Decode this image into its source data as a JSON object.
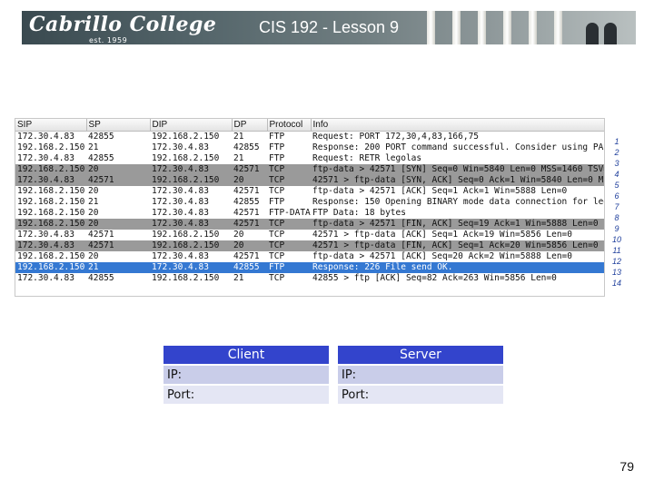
{
  "header": {
    "logo_text": "Cabrillo College",
    "logo_est": "est. 1959",
    "title": "CIS 192 - Lesson 9"
  },
  "packets": {
    "columns": [
      "SIP",
      "SP",
      "DIP",
      "DP",
      "Protocol",
      "Info"
    ],
    "rows": [
      {
        "style": "w",
        "cells": [
          "172.30.4.83",
          "42855",
          "192.168.2.150",
          "21",
          "FTP",
          "Request: PORT 172,30,4,83,166,75"
        ]
      },
      {
        "style": "w",
        "cells": [
          "192.168.2.150",
          "21",
          "172.30.4.83",
          "42855",
          "FTP",
          "Response: 200 PORT command successful. Consider using PASV"
        ]
      },
      {
        "style": "w",
        "cells": [
          "172.30.4.83",
          "42855",
          "192.168.2.150",
          "21",
          "FTP",
          "Request: RETR legolas"
        ]
      },
      {
        "style": "g",
        "cells": [
          "192.168.2.150",
          "20",
          "172.30.4.83",
          "42571",
          "TCP",
          "ftp-data > 42571 [SYN] Seq=0 Win=5840 Len=0 MSS=1460 TSV="
        ]
      },
      {
        "style": "g",
        "cells": [
          "172.30.4.83",
          "42571",
          "192.168.2.150",
          "20",
          "TCP",
          "42571 > ftp-data [SYN, ACK] Seq=0 Ack=1 Win=5840 Len=0 MS"
        ]
      },
      {
        "style": "w",
        "cells": [
          "192.168.2.150",
          "20",
          "172.30.4.83",
          "42571",
          "TCP",
          "ftp-data > 42571 [ACK] Seq=1 Ack=1 Win=5888 Len=0"
        ]
      },
      {
        "style": "w",
        "cells": [
          "192.168.2.150",
          "21",
          "172.30.4.83",
          "42855",
          "FTP",
          "Response: 150 Opening BINARY mode data connection for leg"
        ]
      },
      {
        "style": "w",
        "cells": [
          "192.168.2.150",
          "20",
          "172.30.4.83",
          "42571",
          "FTP-DATA",
          "FTP Data: 18 bytes"
        ]
      },
      {
        "style": "g",
        "cells": [
          "192.168.2.150",
          "20",
          "172.30.4.83",
          "42571",
          "TCP",
          "ftp-data > 42571 [FIN, ACK] Seq=19 Ack=1 Win=5888 Len=0"
        ]
      },
      {
        "style": "w",
        "cells": [
          "172.30.4.83",
          "42571",
          "192.168.2.150",
          "20",
          "TCP",
          "42571 > ftp-data [ACK] Seq=1 Ack=19 Win=5856 Len=0"
        ]
      },
      {
        "style": "g",
        "cells": [
          "172.30.4.83",
          "42571",
          "192.168.2.150",
          "20",
          "TCP",
          "42571 > ftp-data [FIN, ACK] Seq=1 Ack=20 Win=5856 Len=0"
        ]
      },
      {
        "style": "w",
        "cells": [
          "192.168.2.150",
          "20",
          "172.30.4.83",
          "42571",
          "TCP",
          "ftp-data > 42571 [ACK] Seq=20 Ack=2 Win=5888 Len=0"
        ]
      },
      {
        "style": "s",
        "cells": [
          "192.168.2.150",
          "21",
          "172.30.4.83",
          "42855",
          "FTP",
          "Response: 226 File send OK."
        ]
      },
      {
        "style": "w",
        "cells": [
          "172.30.4.83",
          "42855",
          "192.168.2.150",
          "21",
          "TCP",
          "42855 > ftp [ACK] Seq=82 Ack=263 Win=5856 Len=0"
        ]
      }
    ]
  },
  "line_numbers": [
    "1",
    "2",
    "3",
    "4",
    "5",
    "6",
    "7",
    "8",
    "9",
    "10",
    "11",
    "12",
    "13",
    "14"
  ],
  "client_server": {
    "client_header": "Client",
    "server_header": "Server",
    "ip_label": "IP:",
    "port_label": "Port:"
  },
  "page_number": "79",
  "colors": {
    "header_blue": "#3344cc",
    "selected_row": "#3478d2",
    "gray_row": "#9a9a9a",
    "line_number_text": "#1f3f9c"
  }
}
